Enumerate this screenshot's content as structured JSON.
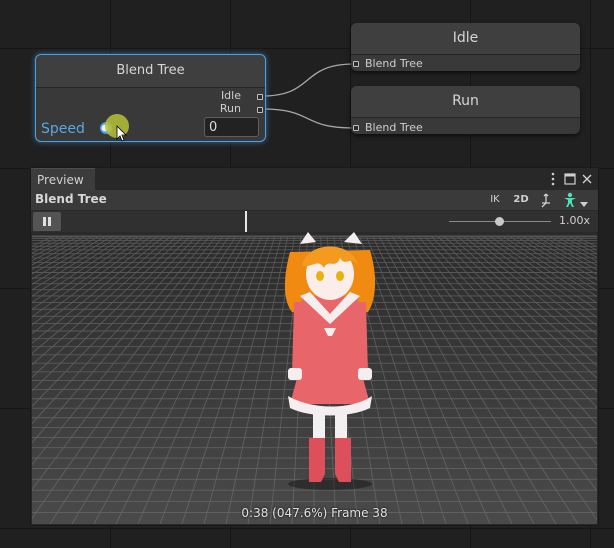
{
  "graph": {
    "blend_node": {
      "title": "Blend Tree",
      "out_ports": [
        "Idle",
        "Run"
      ],
      "param_label": "Speed",
      "param_value": "0"
    },
    "idle_node": {
      "title": "Idle",
      "in_port": "Blend Tree"
    },
    "run_node": {
      "title": "Run",
      "in_port": "Blend Tree"
    }
  },
  "preview": {
    "tab_label": "Preview",
    "title": "Blend Tree",
    "toolbar": {
      "ik": "IK",
      "mode_2d": "2D"
    },
    "speed": "1.00x",
    "frame_info": "0:38 (047.6%) Frame 38"
  },
  "colors": {
    "accent": "#4aa0e6",
    "speed_label": "#5aa7e6",
    "avatar_icon": "#4ee0b8"
  },
  "icons": [
    "kebab-menu-icon",
    "maximize-icon",
    "close-icon",
    "pivot-icon",
    "avatar-icon",
    "dropdown-icon",
    "pause-icon"
  ]
}
